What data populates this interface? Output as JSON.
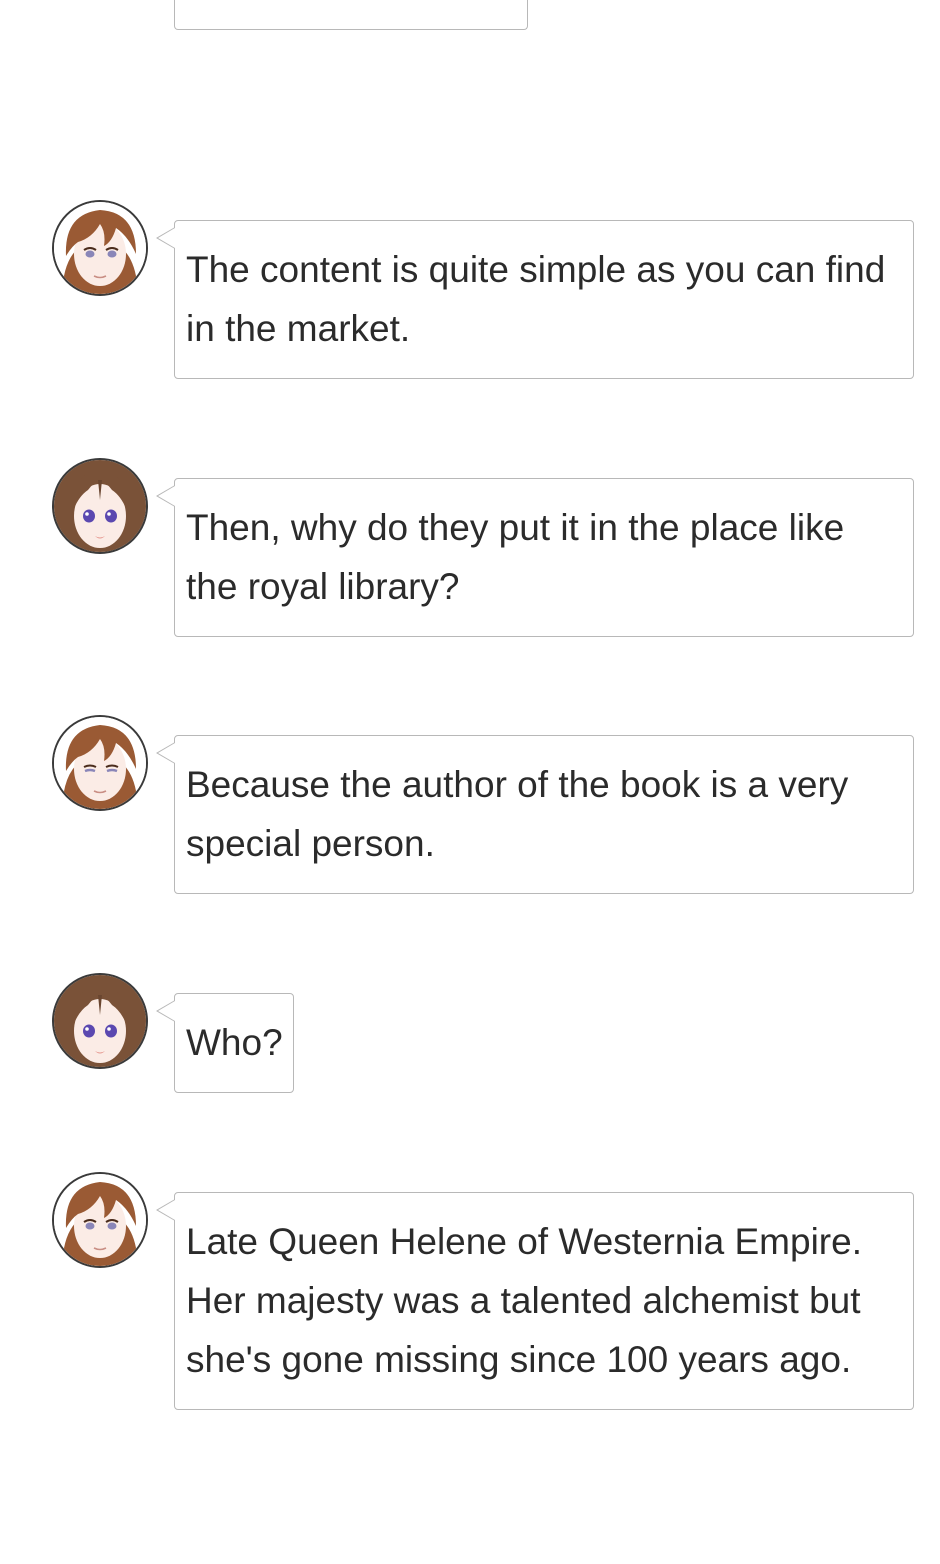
{
  "chat": {
    "messages": [
      {
        "speaker_icon": "male-character-avatar-icon",
        "text": "The content is quite simple as you can find in the market."
      },
      {
        "speaker_icon": "female-character-avatar-icon",
        "text": "Then, why do they put it in the place like the royal library?"
      },
      {
        "speaker_icon": "male-character-avatar-icon",
        "text": "Because the author of the book is a very special person."
      },
      {
        "speaker_icon": "female-character-avatar-icon",
        "text": "Who?"
      },
      {
        "speaker_icon": "male-character-avatar-icon",
        "text": "Late Queen Helene of Westernia Empire. Her majesty was a talented alchemist but she's gone missing since 100 years ago."
      }
    ]
  },
  "colors": {
    "bubble_border": "#b8b8b8",
    "text": "#2b2b2b",
    "avatar_border": "#3a3a3a",
    "male_hair": "#9a5a34",
    "female_hair": "#7a5238",
    "eyes_male": "#8a86b8",
    "eyes_female": "#5b48b0",
    "skin": "#fbece6"
  }
}
